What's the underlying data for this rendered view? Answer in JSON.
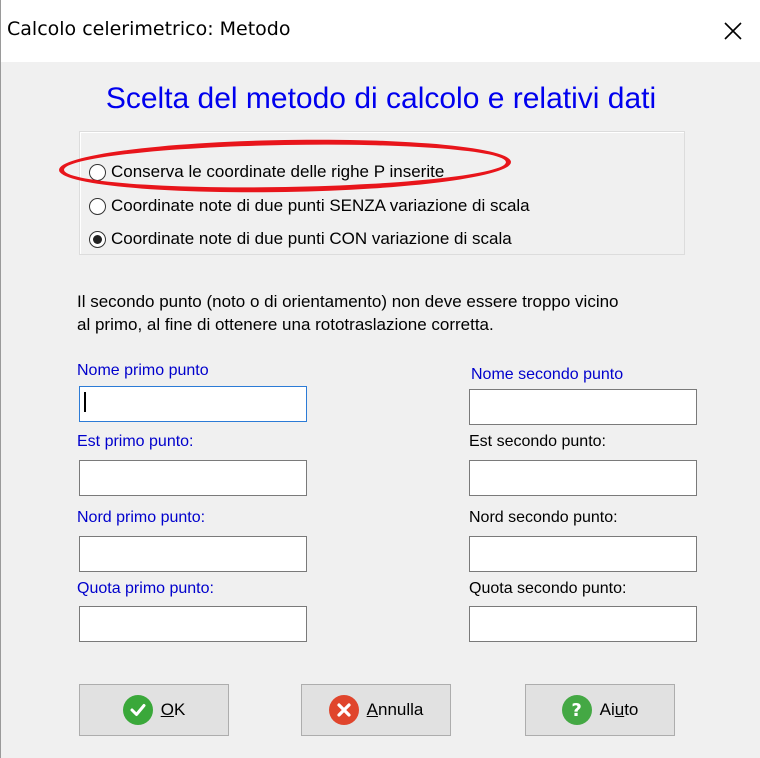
{
  "window": {
    "title": "Calcolo celerimetrico: Metodo",
    "close_glyph": "✕"
  },
  "heading": "Scelta del metodo di calcolo e relativi dati",
  "method_options": [
    {
      "label": "Conserva le coordinate delle righe P inserite",
      "checked": false
    },
    {
      "label": "Coordinate note di due punti SENZA variazione di scala",
      "checked": false
    },
    {
      "label": "Coordinate note di due punti CON variazione di scala",
      "checked": true
    }
  ],
  "info_text_line1": "Il secondo punto (noto o di orientamento) non deve essere troppo vicino",
  "info_text_line2": "al primo, al fine di ottenere una rototraslazione corretta.",
  "fields": {
    "nome_primo": {
      "label": "Nome primo punto",
      "value": ""
    },
    "nome_secondo": {
      "label": "Nome secondo punto",
      "value": ""
    },
    "est_primo": {
      "label": "Est primo punto:",
      "value": ""
    },
    "est_secondo": {
      "label": "Est secondo punto:",
      "value": ""
    },
    "nord_primo": {
      "label": "Nord primo punto:",
      "value": ""
    },
    "nord_secondo": {
      "label": "Nord secondo punto:",
      "value": ""
    },
    "quota_primo": {
      "label": "Quota primo punto:",
      "value": ""
    },
    "quota_secondo": {
      "label": "Quota secondo punto:",
      "value": ""
    }
  },
  "buttons": {
    "ok": {
      "mnemonic": "O",
      "rest": "K",
      "icon": "check-icon"
    },
    "annulla": {
      "mnemonic": "A",
      "rest": "nnulla",
      "icon": "cancel-x-icon"
    },
    "aiuto": {
      "pre": "Ai",
      "mnemonic": "u",
      "rest": "to",
      "icon": "help-icon"
    }
  },
  "colors": {
    "heading": "#0000ee",
    "label_blue": "#0000cc",
    "annotation_red": "#e8151b",
    "ok_green": "#3aa83a",
    "cancel_red": "#e0452c",
    "help_green": "#44a844"
  }
}
